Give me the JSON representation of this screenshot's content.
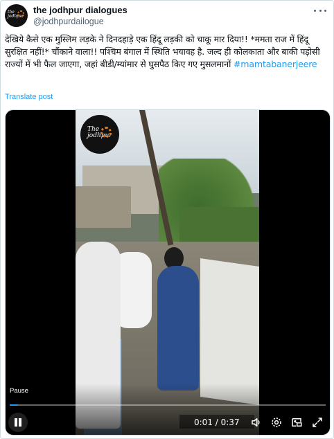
{
  "author": {
    "display_name": "the jodhpur dialogues",
    "handle": "@jodhpurdailogue",
    "avatar_text": "the jodhpur"
  },
  "tweet": {
    "text": "देखिये कैसे एक मुस्लिम लड़के ने दिनदहाड़े एक हिंदू लड़की को चाकू मार दिया!! *ममता राज में हिंदू सुरक्षित नहीं!* चौंकाने वाला!! पश्चिम बंगाल में स्थिति भयावह है. जल्द ही कोलकाता और बाकी पड़ोसी राज्यों में भी फैल जाएगा, जहां बीडी/म्यांमार से घुसपैठ किए गए मुसलमानों ",
    "hashtag": "#mamtabanerjeere",
    "translate_label": "Translate post"
  },
  "video": {
    "channel_logo_text": "The jodhpur",
    "tooltip": "Pause",
    "current_time": "0:01",
    "separator": " / ",
    "duration": "0:37",
    "progress_fraction": 0.027
  },
  "icons": {
    "more": "more-horizontal-icon",
    "pause": "pause-icon",
    "volume": "volume-icon",
    "settings": "settings-gear-icon",
    "pip": "picture-in-picture-icon",
    "fullscreen": "fullscreen-icon"
  },
  "colors": {
    "accent": "#1d9bf0",
    "text": "#0f1419",
    "secondary": "#536471"
  }
}
